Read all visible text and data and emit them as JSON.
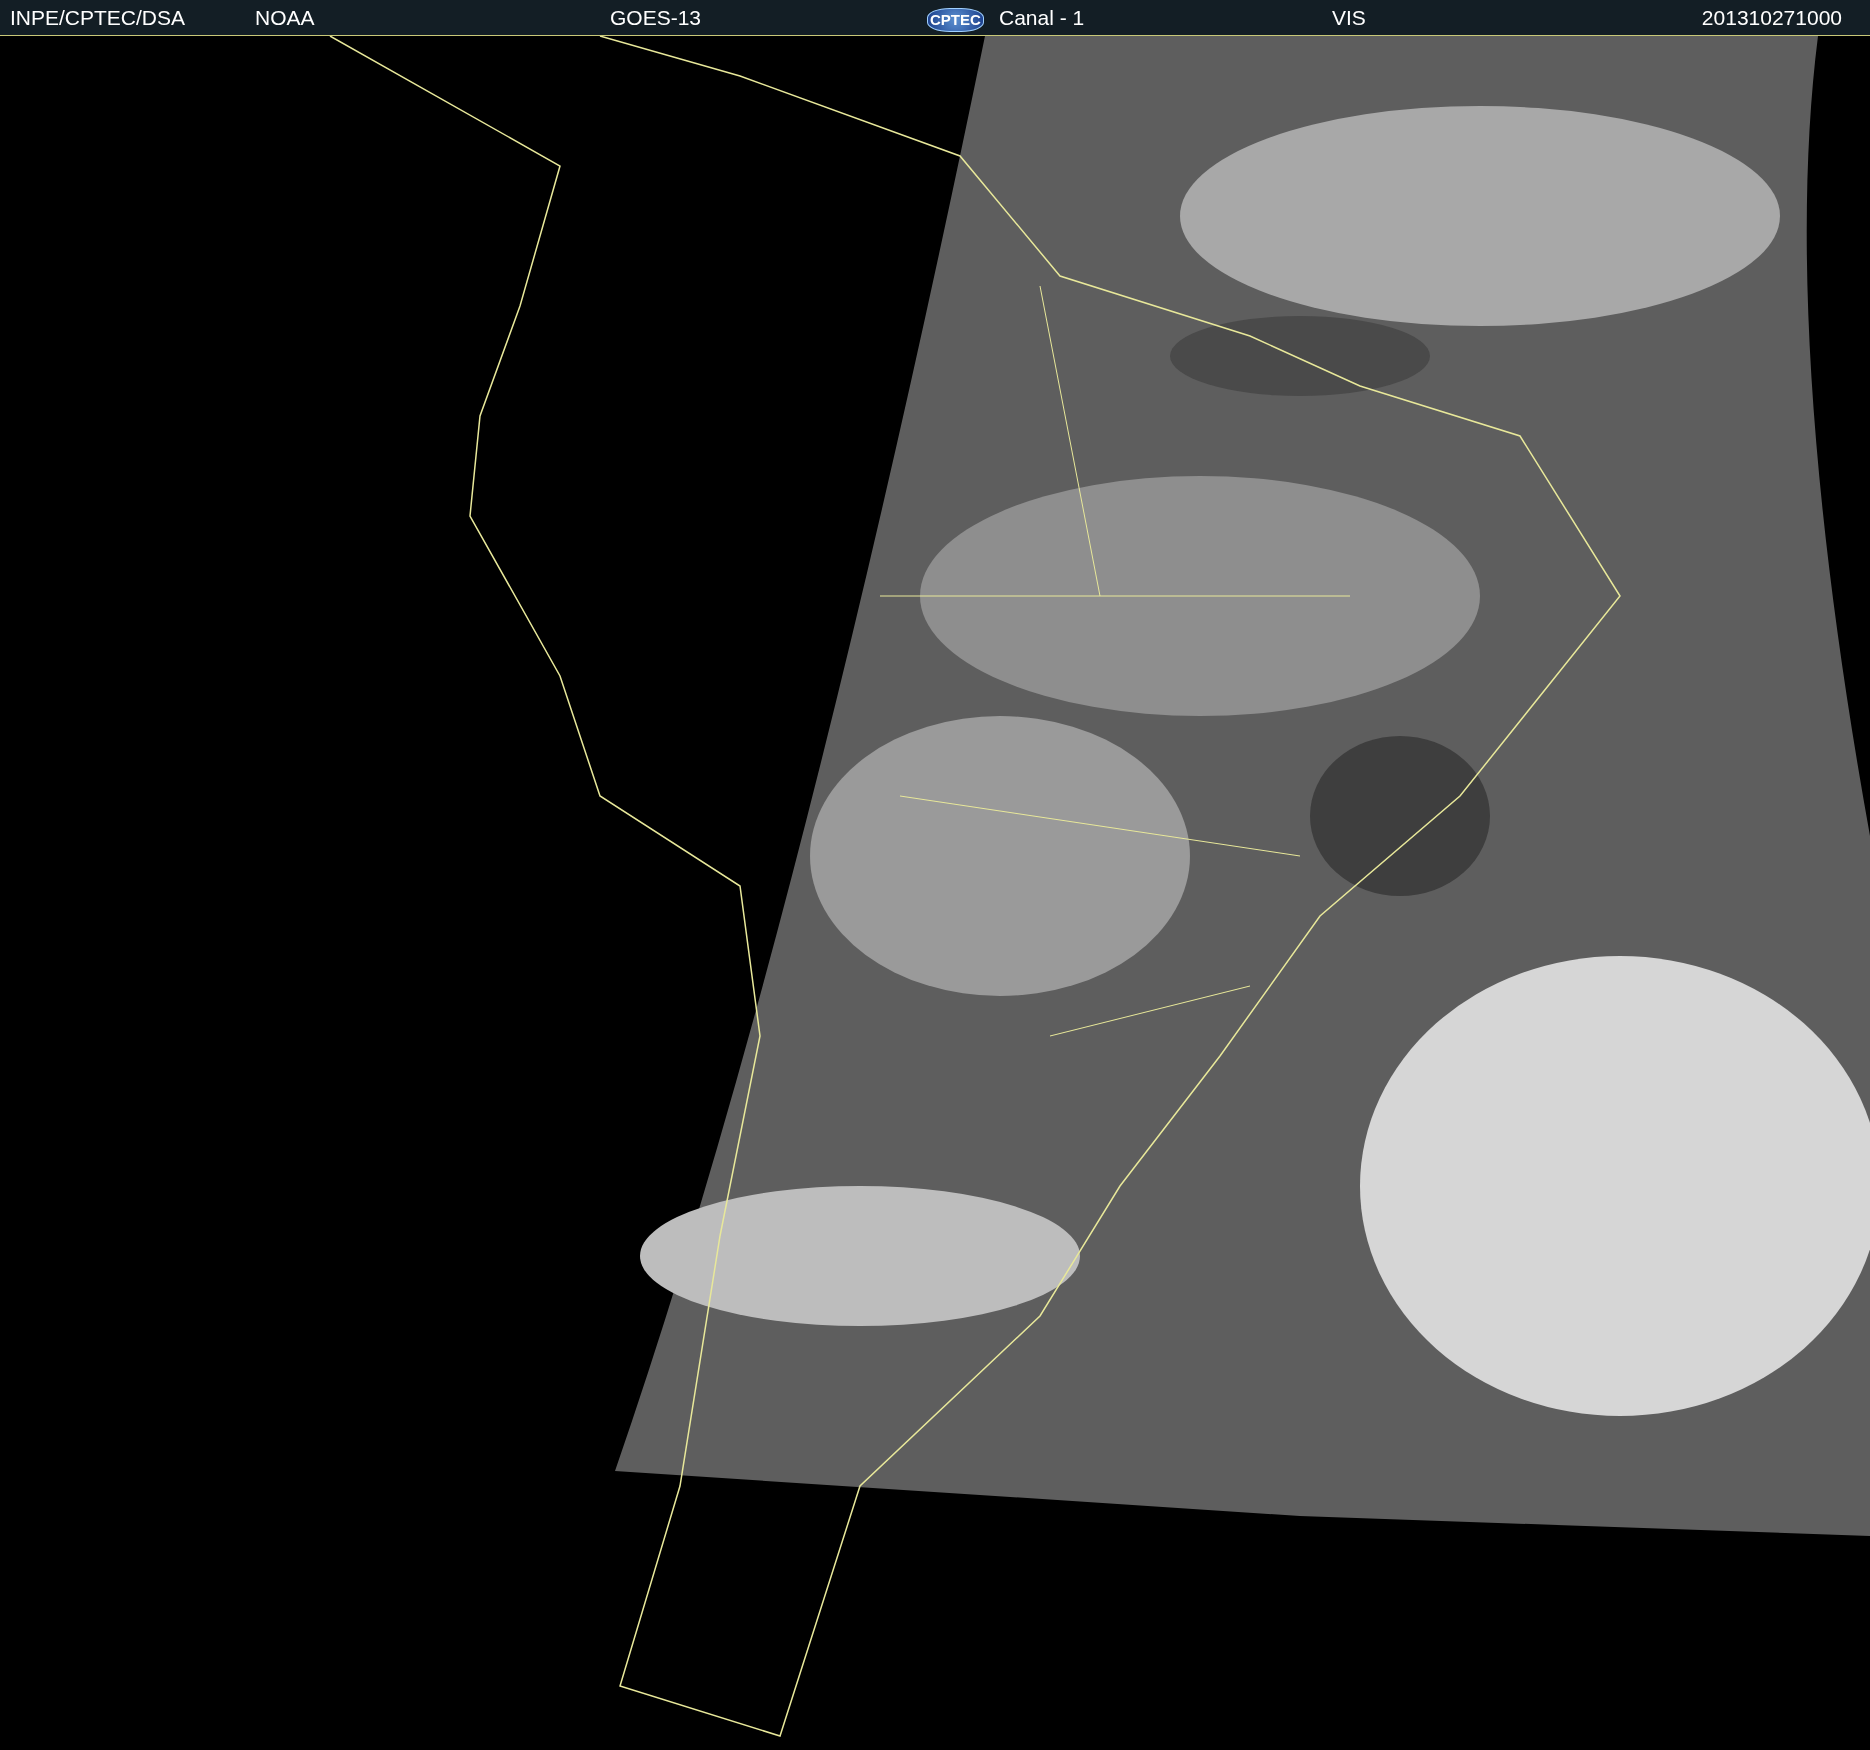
{
  "header": {
    "items": [
      {
        "kind": "text",
        "text": "INPE/CPTEC/DSA"
      },
      {
        "kind": "text",
        "text": "NOAA"
      },
      {
        "kind": "text",
        "text": "GOES-13"
      },
      {
        "kind": "logo",
        "text": "CPTEC"
      },
      {
        "kind": "text",
        "text": "Canal - 1"
      },
      {
        "kind": "text",
        "text": "VIS"
      },
      {
        "kind": "text",
        "text": "201310271000"
      }
    ]
  }
}
